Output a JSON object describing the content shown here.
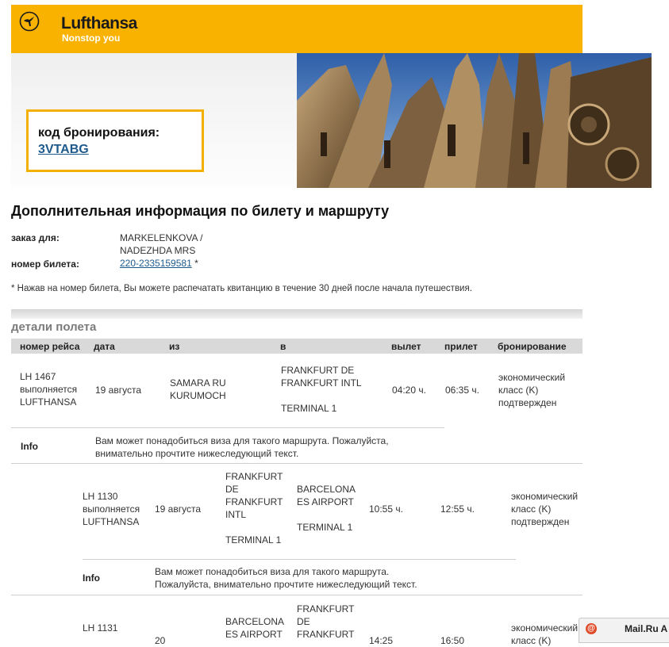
{
  "header": {
    "brand_name": "Lufthansa",
    "brand_tagline": "Nonstop you",
    "brand_color": "#f9b200",
    "logo_icon": "crane-logo-icon"
  },
  "booking": {
    "label": "код бронирования:",
    "code": "3VTABG"
  },
  "page_title": "Дополнительная информация по билету и маршруту",
  "passenger": {
    "order_label": "заказ для:",
    "name_line1": "MARKELENKOVA /",
    "name_line2": "NADEZHDA MRS",
    "ticket_label": "номер билета:",
    "ticket_number": "220-2335159581",
    "ticket_mark": "*"
  },
  "note": "* Нажав на номер билета, Вы можете распечатать квитанцию в течение 30 дней после начала путешествия.",
  "flight_details": {
    "title": "детали полета",
    "columns": [
      "номер рейса",
      "дата",
      "из",
      "в",
      "вылет",
      "прилет",
      "бронирование"
    ],
    "flights": [
      {
        "number": "LH 1467",
        "operated_line1": "выполняется",
        "operated_line2": "LUFTHANSA",
        "date": "19 августа",
        "from_line1": "SAMARA RU",
        "from_line2": "KURUMOCH",
        "to_line1": "FRANKFURT DE",
        "to_line2": "FRANKFURT INTL",
        "to_terminal": "TERMINAL 1",
        "departure": "04:20 ч.",
        "arrival": "06:35 ч.",
        "booking_line1": "экономический",
        "booking_line2": "класс (K)",
        "booking_line3": "подтвержден",
        "info_label": "Info",
        "info_line1": "Вам может понадобиться виза для такого маршрута. Пожалуйста,",
        "info_line2": "внимательно прочтите нижеследующий текст."
      },
      {
        "number": "LH 1130",
        "operated_line1": "выполняется",
        "operated_line2": "LUFTHANSA",
        "date": "19 августа",
        "from_line1": "FRANKFURT",
        "from_line2": "DE",
        "from_line3": "FRANKFURT",
        "from_line4": "INTL",
        "from_terminal": "TERMINAL 1",
        "to_line1": "BARCELONA",
        "to_line2": "ES AIRPORT",
        "to_terminal": "TERMINAL 1",
        "departure": "10:55 ч.",
        "arrival": "12:55 ч.",
        "booking_line1": "экономический",
        "booking_line2": "класс (K)",
        "booking_line3": "подтвержден",
        "info_label": "Info",
        "info_line1": "Вам может понадобиться виза для такого маршрута.",
        "info_line2": "Пожалуйста, внимательно прочтите нижеследующий текст."
      },
      {
        "number": "LH 1131",
        "date_partial": "20",
        "from_line1": "BARCELONA",
        "from_line2": "ES AIRPORT",
        "to_line1": "FRANKFURT",
        "to_line2": "DE",
        "to_line3": "FRANKFURT",
        "departure_partial": "14:25",
        "arrival_partial": "16:50",
        "booking_line1": "экономический",
        "booking_line2": "класс (K)"
      }
    ]
  },
  "mail_tab": {
    "icon": "at-sign-icon",
    "label": "Mail.Ru A"
  }
}
